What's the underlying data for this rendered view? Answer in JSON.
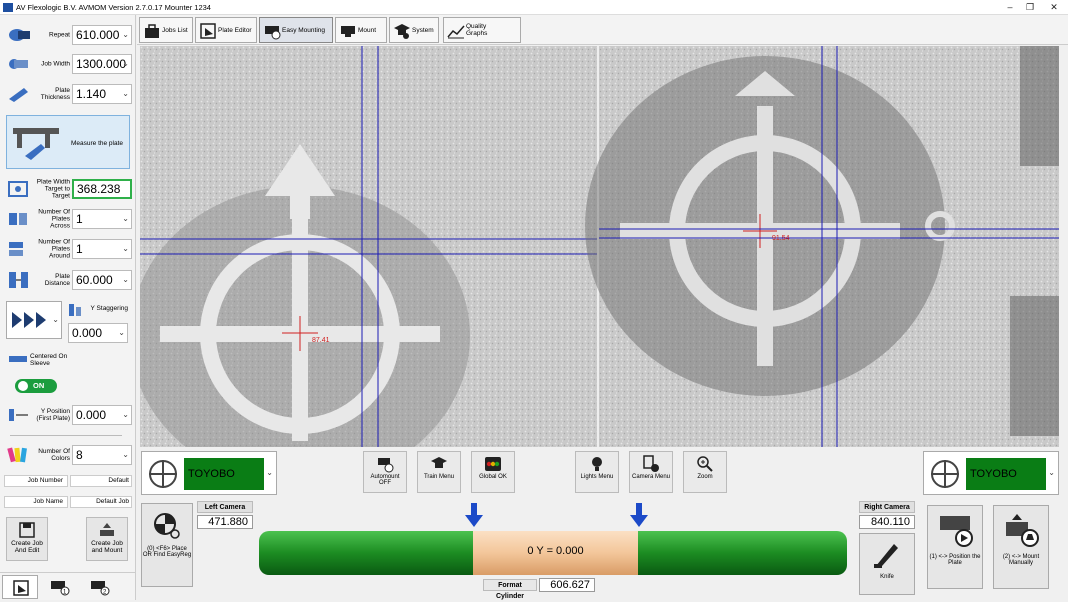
{
  "window": {
    "title": "AV Flexologic B.V.  AVMOM  Version 2.7.0.17   Mounter 1234"
  },
  "toolbar": {
    "jobs": "Jobs List",
    "plate": "Plate Editor",
    "easy": "Easy Mounting",
    "mount": "Mount",
    "system": "System",
    "quality": "Quality Graphs"
  },
  "sidebar": {
    "repeat": {
      "label": "Repeat",
      "value": "610.000"
    },
    "job_width": {
      "label": "Job Width",
      "value": "1300.000"
    },
    "plate_thickness": {
      "label": "Plate Thickness",
      "value": "1.140"
    },
    "measure": "Measure the plate",
    "plate_width": {
      "label": "Plate Width Target to Target",
      "value": "368.238"
    },
    "plates_across": {
      "label": "Number Of Plates Across",
      "value": "1"
    },
    "plates_around": {
      "label": "Number Of Plates Around",
      "value": "1"
    },
    "plate_distance": {
      "label": "Plate Distance",
      "value": "60.000"
    },
    "staggering": {
      "label": "Y Staggering",
      "value": "0.000"
    },
    "centered": "Centered On Sleeve",
    "toggle": "ON",
    "y_position": {
      "label": "Y Position (First Plate)",
      "value": "0.000"
    },
    "colors": {
      "label": "Number Of Colors",
      "value": "8"
    },
    "job_number": {
      "label": "Job Number",
      "value": "Default"
    },
    "job_name": {
      "label": "Job Name",
      "value": "Default Job"
    },
    "create_edit": "Create Job And Edit",
    "create_mount": "Create Job and Mount"
  },
  "cameras": {
    "left_readout": "87.41",
    "right_readout": "91.54"
  },
  "controls": {
    "left_material": "TOYOBO",
    "right_material": "TOYOBO",
    "automount": "Automount OFF",
    "train": "Train Menu",
    "global_ok": "Global OK",
    "lights": "Lights Menu",
    "camera": "Camera Menu",
    "zoom": "Zoom"
  },
  "bottom": {
    "place_easyreg": "(0) <F6> Place OR Find EasyReg",
    "left_camera": {
      "label": "Left Camera",
      "value": "471.880"
    },
    "right_camera": {
      "label": "Right Camera",
      "value": "840.110"
    },
    "sleeve_label": "0 Y = 0.000",
    "format_cylinder": {
      "label": "Format Cylinder",
      "value": "606.627"
    },
    "knife": "Knife",
    "position_plate": "(1) <-> Position the Plate",
    "mount_manually": "(2) <-> Mount Manually"
  },
  "colors": {
    "accent_green": "#0a7d15",
    "cross_blue": "#1c1cb5",
    "cross_red": "#d02020",
    "sleeve_green": "#1c8c22",
    "sleeve_plate": "#f3c69a"
  }
}
